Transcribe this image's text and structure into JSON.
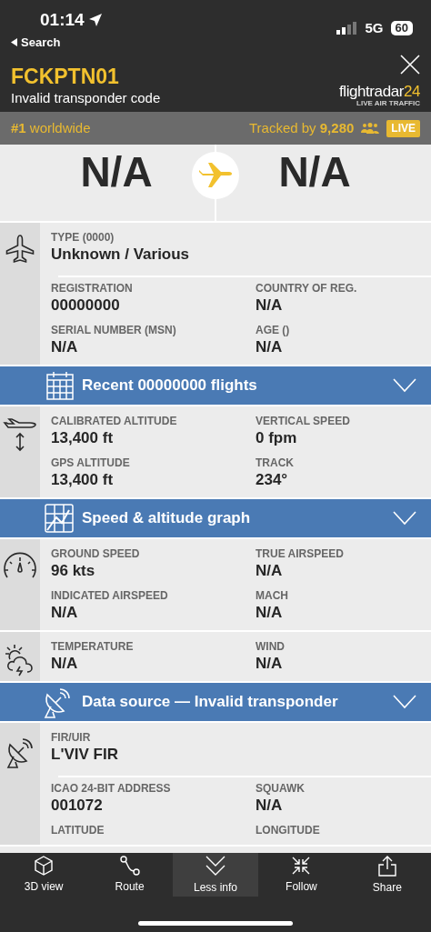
{
  "status_bar": {
    "time": "01:14",
    "back_label": "Search",
    "network": "5G",
    "battery": "60"
  },
  "header": {
    "callsign": "FCKPTN01",
    "subtitle": "Invalid transponder code",
    "logo": {
      "name": "flightradar",
      "accent": "24",
      "tagline": "LIVE AIR TRAFFIC"
    }
  },
  "stats": {
    "rank": "**#1** worldwide",
    "tracked": "Tracked by **9,280**",
    "badge": "LIVE"
  },
  "route": {
    "origin": "N/A",
    "destination": "N/A"
  },
  "aircraft": {
    "rows": [
      [
        {
          "label": "TYPE (0000)",
          "value": "Unknown / Various"
        }
      ],
      [
        {
          "label": "REGISTRATION",
          "value": "00000000"
        },
        {
          "label": "COUNTRY OF REG.",
          "value": "N/A"
        }
      ],
      [
        {
          "label": "SERIAL NUMBER (MSN)",
          "value": "N/A"
        },
        {
          "label": "AGE ()",
          "value": "N/A"
        }
      ]
    ]
  },
  "recent_flights": {
    "title": "Recent 00000000 flights",
    "expanded": false
  },
  "altitude": {
    "rows": [
      [
        {
          "label": "CALIBRATED ALTITUDE",
          "value": "13,400 ft"
        },
        {
          "label": "VERTICAL SPEED",
          "value": "0 fpm"
        }
      ],
      [
        {
          "label": "GPS ALTITUDE",
          "value": "13,400 ft"
        },
        {
          "label": "TRACK",
          "value": "234°"
        }
      ]
    ]
  },
  "speed_graph": {
    "title": "Speed & altitude graph",
    "expanded": false
  },
  "speed": {
    "rows": [
      [
        {
          "label": "GROUND SPEED",
          "value": "96 kts"
        },
        {
          "label": "TRUE AIRSPEED",
          "value": "N/A"
        }
      ],
      [
        {
          "label": "INDICATED AIRSPEED",
          "value": "N/A"
        },
        {
          "label": "MACH",
          "value": "N/A"
        }
      ]
    ]
  },
  "weather": {
    "rows": [
      [
        {
          "label": "TEMPERATURE",
          "value": "N/A"
        },
        {
          "label": "WIND",
          "value": "N/A"
        }
      ]
    ]
  },
  "data_source": {
    "title": "Data source — Invalid transponder",
    "expanded": false
  },
  "source_details": {
    "rows": [
      [
        {
          "label": "FIR/UIR",
          "value": "L'VIV FIR"
        }
      ],
      [
        {
          "label": "ICAO 24-BIT ADDRESS",
          "value": "001072"
        },
        {
          "label": "SQUAWK",
          "value": "N/A"
        }
      ],
      [
        {
          "label": "LATITUDE"
        },
        {
          "label": "LONGITUDE"
        }
      ]
    ]
  },
  "bottom_nav": [
    {
      "label": "3D view",
      "selected": false
    },
    {
      "label": "Route",
      "selected": false
    },
    {
      "label": "Less info",
      "selected": true
    },
    {
      "label": "Follow",
      "selected": false
    },
    {
      "label": "Share",
      "selected": false
    }
  ]
}
